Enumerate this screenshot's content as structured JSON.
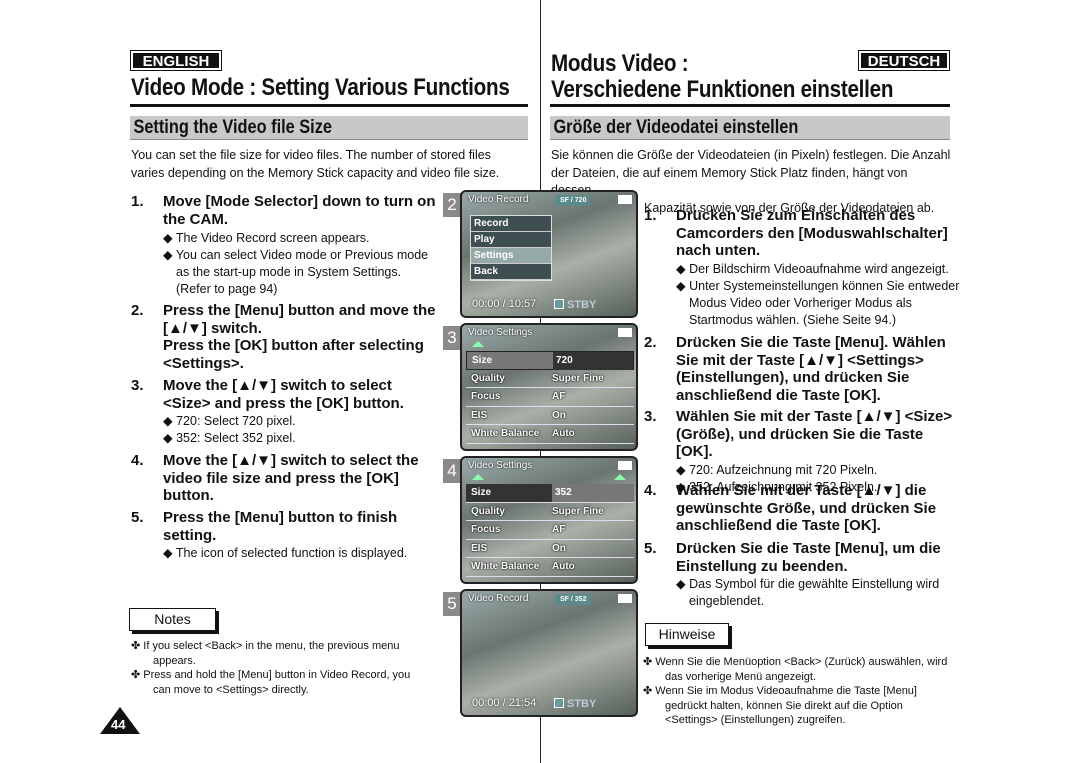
{
  "en": {
    "lang": "ENGLISH",
    "title": "Video Mode : Setting Various Functions",
    "section": "Setting the Video file Size",
    "intro": [
      "You can set the file size for video files. The number of stored files",
      "varies depending on the Memory Stick capacity and video file size."
    ],
    "steps": [
      {
        "num": "1.",
        "lines": [
          "Move [Mode Selector] down to turn on",
          "the CAM."
        ],
        "bullets": [
          "◆ The Video Record screen appears.",
          "◆ You can select Video mode or Previous mode as the start-up mode in System Settings. (Refer to page 94)"
        ]
      },
      {
        "num": "2.",
        "lines": [
          "Press the [Menu] button and move the",
          "[▲/▼] switch.",
          "Press the [OK] button after selecting",
          "<Settings>."
        ],
        "bullets": []
      },
      {
        "num": "3.",
        "lines": [
          "Move the [▲/▼] switch to select",
          "<Size> and press the [OK] button."
        ],
        "bullets": [
          "◆ 720: Select 720 pixel.",
          "◆ 352: Select 352 pixel."
        ]
      },
      {
        "num": "4.",
        "lines": [
          "Move the [▲/▼] switch to select the",
          "video file size and press the [OK]",
          "button."
        ],
        "bullets": []
      },
      {
        "num": "5.",
        "lines": [
          "Press the [Menu] button to finish",
          "setting."
        ],
        "bullets": [
          "◆ The icon of selected function is displayed."
        ]
      }
    ],
    "notes_label": "Notes",
    "notes": [
      "✤ If you select <Back> in the menu, the previous menu appears.",
      "✤ Press and hold the [Menu] button in Video Record, you can move to <Settings> directly."
    ],
    "page": "44"
  },
  "de": {
    "lang": "DEUTSCH",
    "title1": "Modus Video :",
    "title2": "Verschiedene Funktionen einstellen",
    "section": "Größe der Videodatei einstellen",
    "intro": [
      "Sie können die Größe der Videodateien (in Pixeln) festlegen. Die Anzahl",
      "der Dateien, die auf einem Memory Stick Platz finden, hängt von dessen",
      "Kapazität sowie von der Größe der Videodateien ab."
    ],
    "steps": [
      {
        "num": "1.",
        "lines": [
          "Drücken Sie zum Einschalten des",
          "Camcorders den [Moduswahlschalter]",
          "nach unten."
        ],
        "bullets": [
          "◆ Der Bildschirm Videoaufnahme wird angezeigt.",
          "◆ Unter Systemeinstellungen können Sie entweder Modus Video oder Vorheriger Modus als Startmodus wählen. (Siehe Seite 94.)"
        ]
      },
      {
        "num": "2.",
        "lines": [
          "Drücken Sie die Taste [Menu]. Wählen",
          "Sie mit der Taste [▲/▼] <Settings>",
          "(Einstellungen), und drücken Sie",
          "anschließend die Taste [OK]."
        ],
        "bullets": []
      },
      {
        "num": "3.",
        "lines": [
          "Wählen Sie mit der Taste [▲/▼] <Size>",
          "(Größe), und drücken Sie die Taste [OK]."
        ],
        "bullets": [
          "◆ 720: Aufzeichnung mit 720 Pixeln.",
          "◆ 352: Aufzeichnung mit 352 Pixeln."
        ]
      },
      {
        "num": "4.",
        "lines": [
          "Wählen Sie mit der Taste [▲/▼] die",
          "gewünschte Größe, und drücken Sie",
          "anschließend die Taste [OK]."
        ],
        "bullets": []
      },
      {
        "num": "5.",
        "lines": [
          "Drücken Sie die Taste [Menu], um die",
          "Einstellung zu beenden."
        ],
        "bullets": [
          "◆ Das Symbol für die gewählte Einstellung wird eingeblendet."
        ]
      }
    ],
    "notes_label": "Hinweise",
    "notes": [
      "✤ Wenn Sie die Menüoption <Back> (Zurück) auswählen, wird das vorherige Menü angezeigt.",
      "✤ Wenn Sie im Modus Videoaufnahme die Taste [Menu] gedrückt halten, können Sie direkt auf die Option <Settings> (Einstellungen) zugreifen."
    ]
  },
  "screens": {
    "s2": {
      "num": "2",
      "title": "Video Record",
      "badge": "SF / 720",
      "menu": [
        "Record",
        "Play",
        "Settings",
        "Back"
      ],
      "time": "00:00 / 10:57",
      "status": "STBY"
    },
    "s3": {
      "num": "3",
      "title": "Video Settings",
      "rows": [
        [
          "Size",
          "720"
        ],
        [
          "Quality",
          "Super Fine"
        ],
        [
          "Focus",
          "AF"
        ],
        [
          "EIS",
          "On"
        ],
        [
          "White Balance",
          "Auto"
        ]
      ]
    },
    "s4": {
      "num": "4",
      "title": "Video Settings",
      "rows": [
        [
          "Size",
          "352"
        ],
        [
          "Quality",
          "Super Fine"
        ],
        [
          "Focus",
          "AF"
        ],
        [
          "EIS",
          "On"
        ],
        [
          "White Balance",
          "Auto"
        ]
      ]
    },
    "s5": {
      "num": "5",
      "title": "Video Record",
      "badge": "SF / 352",
      "time": "00:00 / 21:54",
      "status": "STBY"
    }
  }
}
